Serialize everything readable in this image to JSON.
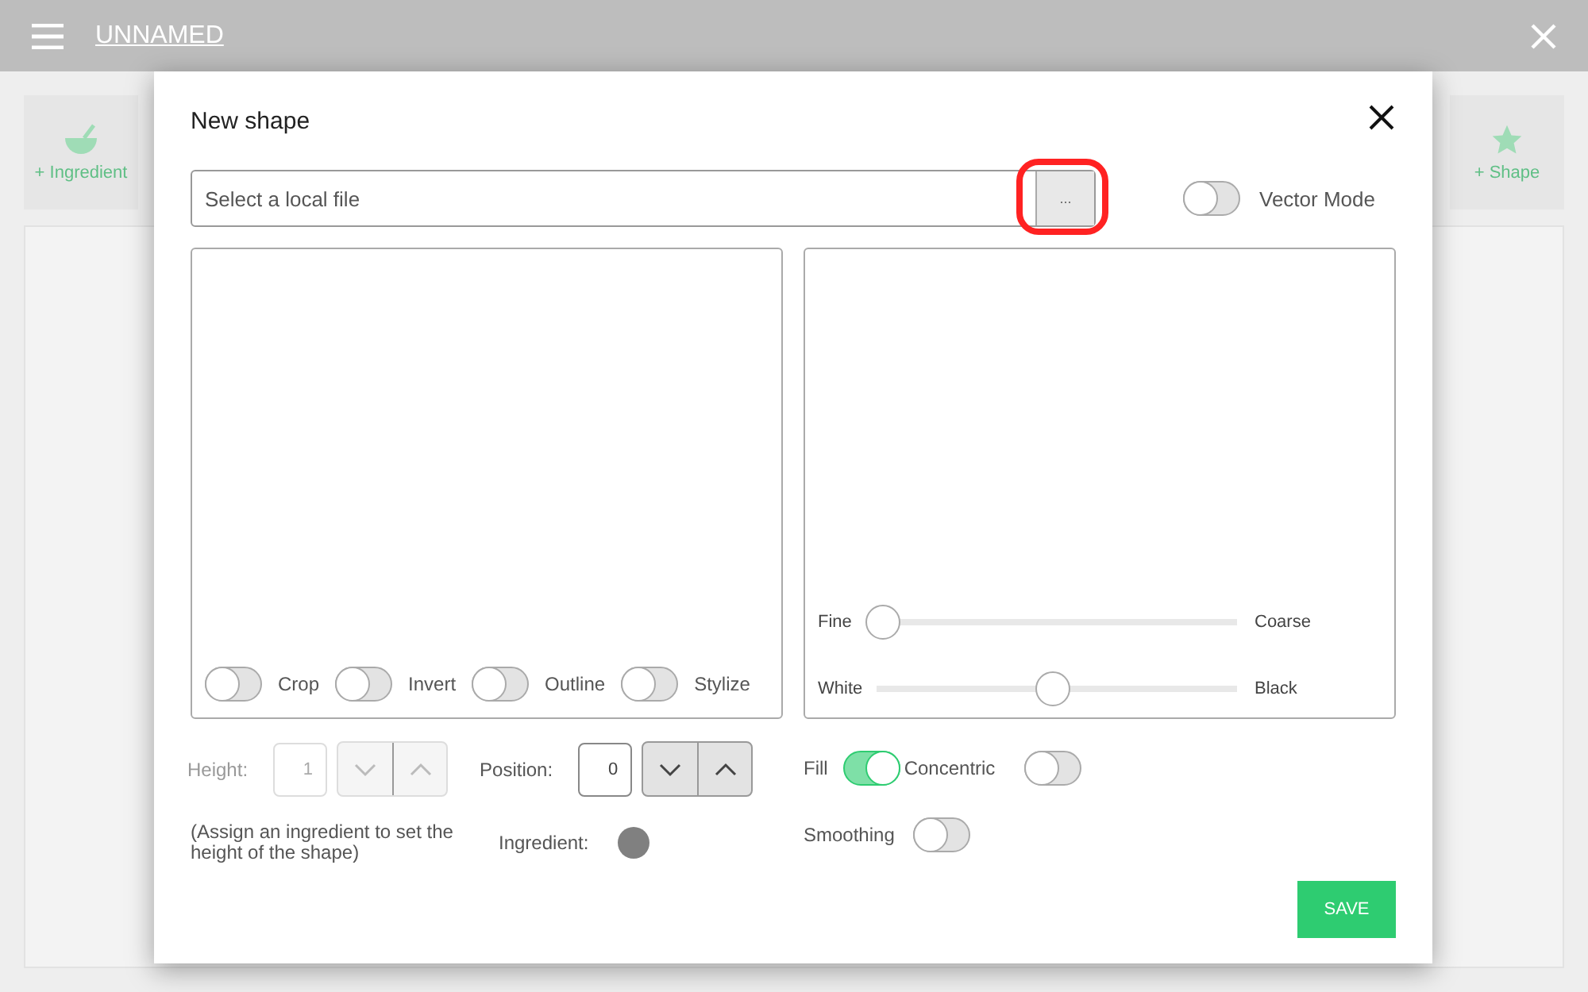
{
  "app_bar": {
    "title": "UNNAMED"
  },
  "background_actions": [
    {
      "label": "+ Ingredient",
      "kind": "ingredient"
    },
    {
      "label": "+ Shape",
      "kind": "shape"
    }
  ],
  "dialog": {
    "title": "New shape",
    "file_field": {
      "placeholder": "Select a local file",
      "browse_label": "...",
      "highlighted": true
    },
    "vector_mode": {
      "label": "Vector Mode",
      "on": false
    },
    "image_toggles": [
      {
        "label": "Crop",
        "on": false
      },
      {
        "label": "Invert",
        "on": false
      },
      {
        "label": "Outline",
        "on": false
      },
      {
        "label": "Stylize",
        "on": false
      }
    ],
    "sliders": [
      {
        "min_label": "Fine",
        "max_label": "Coarse",
        "level": 0.04
      },
      {
        "min_label": "White",
        "max_label": "Black",
        "level": 0.49
      }
    ],
    "height": {
      "label": "Height:",
      "value": "1",
      "disabled": true
    },
    "position": {
      "label": "Position:",
      "value": "0",
      "disabled": false
    },
    "hint": "(Assign an ingredient to set the height of the shape)",
    "ingredient": {
      "label": "Ingredient:",
      "color": "#808080"
    },
    "fill": {
      "label": "Fill",
      "on": true
    },
    "concentric": {
      "label": "Concentric",
      "on": false
    },
    "smoothing": {
      "label": "Smoothing",
      "on": false
    },
    "save_label": "SAVE"
  }
}
